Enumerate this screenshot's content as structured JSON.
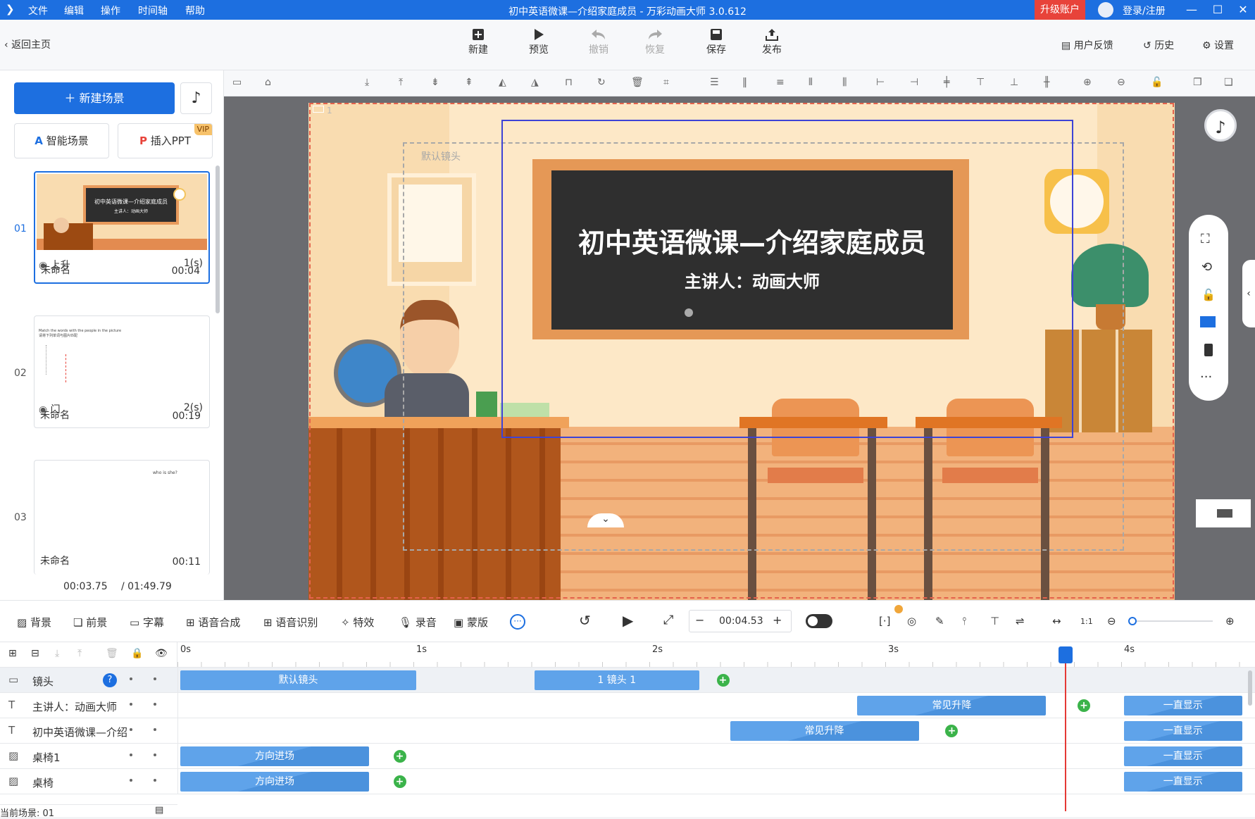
{
  "titlebar": {
    "menu": [
      "文件",
      "编辑",
      "操作",
      "时间轴",
      "帮助"
    ],
    "title": "初中英语微课—介绍家庭成员 - 万彩动画大师 3.0.612",
    "upgrade": "升级账户",
    "login": "登录/注册"
  },
  "toolbar": {
    "back": "返回主页",
    "new": "新建",
    "preview": "预览",
    "undo": "撤销",
    "redo": "恢复",
    "save": "保存",
    "publish": "发布",
    "feedback": "用户反馈",
    "history": "历史",
    "settings": "设置"
  },
  "left": {
    "new_scene": "新建场景",
    "smart_scene": "智能场景",
    "insert_ppt": "插入PPT",
    "vip": "VIP",
    "scenes": [
      {
        "num": "01",
        "name": "未命名",
        "time": "00:04",
        "thumb_title": "初中英语微课—介绍家庭成员",
        "thumb_sub": "主讲人：动画大师"
      },
      {
        "num": "02",
        "name": "未命名",
        "time": "00:19",
        "thumb_title": "Match the words with the people in the picture",
        "thumb_sub": "请将下列单词与图片匹配"
      },
      {
        "num": "03",
        "name": "未命名",
        "time": "00:11",
        "thumb_title": "who is she?"
      }
    ],
    "transitions": [
      {
        "name": "上升",
        "dur": "1(s)"
      },
      {
        "name": "门",
        "dur": "2(s)"
      }
    ],
    "time_current": "00:03.75",
    "time_total": "/ 01:49.79"
  },
  "canvas": {
    "scene_index": "1",
    "default_camera": "默认镜头",
    "board_title": "初中英语微课—介绍家庭成员",
    "board_sub": "主讲人：动画大师"
  },
  "bottombar": {
    "background": "背景",
    "foreground": "前景",
    "subtitle": "字幕",
    "tts": "语音合成",
    "asr": "语音识别",
    "effects": "特效",
    "record": "录音",
    "mask": "蒙版",
    "time": "00:04.53"
  },
  "timeline": {
    "ticks": [
      "0s",
      "1s",
      "2s",
      "3s",
      "4s"
    ],
    "playhead_seconds": 3.75,
    "tracks": [
      {
        "name": "镜头",
        "clips": [
          {
            "label": "默认镜头",
            "start": 0,
            "end": 1.0
          },
          {
            "label": "1 镜头 1",
            "start": 1.5,
            "end": 2.2
          }
        ],
        "keyframes": [
          2.3
        ]
      },
      {
        "name": "主讲人：动画大师",
        "clips": [
          {
            "label": "常见升降",
            "start": 2.87,
            "end": 3.67
          },
          {
            "label": "一直显示",
            "start": 4.0,
            "end": 4.5
          }
        ],
        "keyframes": [
          3.83
        ]
      },
      {
        "name": "初中英语微课—介绍",
        "clips": [
          {
            "label": "常见升降",
            "start": 2.33,
            "end": 3.13
          },
          {
            "label": "一直显示",
            "start": 4.0,
            "end": 4.5
          }
        ],
        "keyframes": [
          3.27
        ]
      },
      {
        "name": "桌椅1",
        "clips": [
          {
            "label": "方向进场",
            "start": 0,
            "end": 0.8
          },
          {
            "label": "一直显示",
            "start": 4.0,
            "end": 4.5
          }
        ],
        "keyframes": [
          0.93
        ]
      },
      {
        "name": "桌椅",
        "clips": [
          {
            "label": "方向进场",
            "start": 0,
            "end": 0.8
          },
          {
            "label": "一直显示",
            "start": 4.0,
            "end": 4.5
          }
        ],
        "keyframes": [
          0.93
        ]
      }
    ],
    "status": "当前场景: 01"
  },
  "colors": {
    "accent": "#1d6fe0",
    "upgrade": "#e8433a",
    "clip": "#5fa3ea",
    "keyframe": "#3bb34a",
    "playhead": "#e53935"
  }
}
